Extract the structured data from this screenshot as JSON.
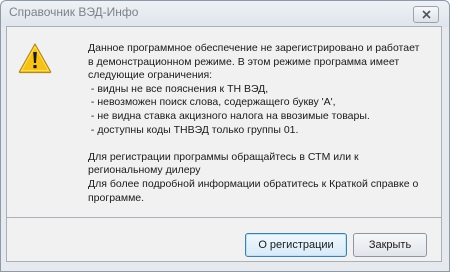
{
  "window": {
    "title": "Справочник ВЭД-Инфо"
  },
  "icons": {
    "warning": "warning-icon",
    "close": "close-icon"
  },
  "message": {
    "lines": [
      "Данное программное обеспечение не зарегистрировано и работает",
      "в демонстрационном режиме. В этом режиме программа имеет",
      "следующие ограничения:",
      " - видны не все пояснения к ТН ВЭД,",
      " - невозможен поиск слова, содержащего букву 'А',",
      " - не видна ставка акцизного налога на ввозимые товары.",
      " - доступны коды ТНВЭД только группы 01.",
      "",
      "Для регистрации программы обращайтесь в СТМ или к",
      "региональному дилеру",
      "Для более подробной информации обратитесь к Краткой справке о",
      "программе."
    ]
  },
  "buttons": {
    "register": "О регистрации",
    "close": "Закрыть"
  },
  "colors": {
    "accent": "#3c7fb1",
    "warning_fill": "#f6c21a"
  }
}
